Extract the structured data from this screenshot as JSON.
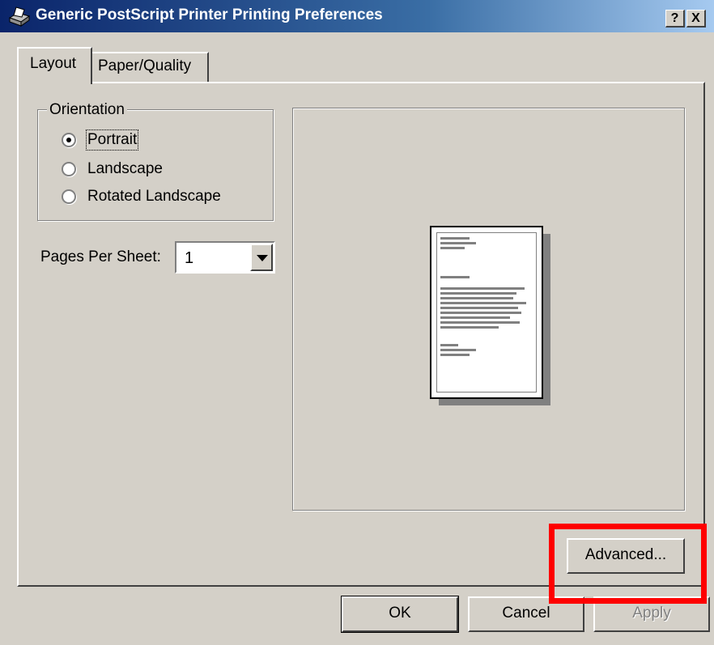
{
  "window": {
    "title": "Generic PostScript Printer Printing Preferences",
    "help_button": "?",
    "close_button": "X"
  },
  "tabs": [
    {
      "label": "Layout",
      "selected": true
    },
    {
      "label": "Paper/Quality",
      "selected": false
    }
  ],
  "orientation": {
    "group_label": "Orientation",
    "options": [
      {
        "label": "Portrait",
        "selected": true
      },
      {
        "label": "Landscape",
        "selected": false
      },
      {
        "label": "Rotated Landscape",
        "selected": false
      }
    ]
  },
  "pages_per_sheet": {
    "label": "Pages Per Sheet:",
    "value": "1"
  },
  "buttons": {
    "advanced": "Advanced...",
    "ok": "OK",
    "cancel": "Cancel",
    "apply": "Apply"
  },
  "colors": {
    "dialog_background": "#d4d0c8",
    "titlebar_start": "#0a246a",
    "highlight": "#ff0000"
  }
}
